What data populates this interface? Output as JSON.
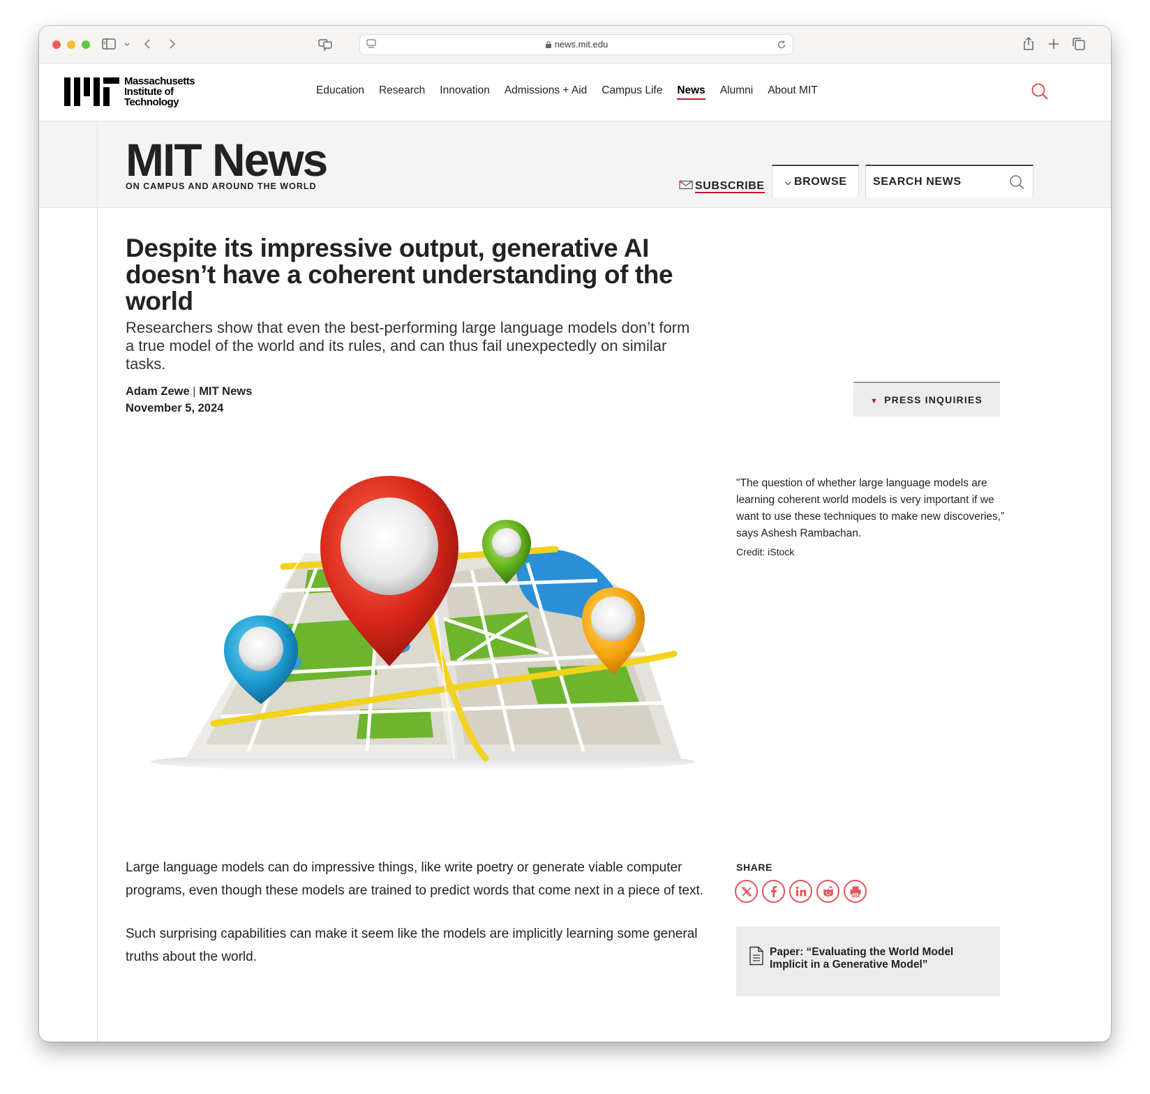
{
  "browser": {
    "url": "news.mit.edu"
  },
  "mit_header": {
    "logo_lines": [
      "Massachusetts",
      "Institute of",
      "Technology"
    ],
    "nav": [
      {
        "label": "Education",
        "active": false
      },
      {
        "label": "Research",
        "active": false
      },
      {
        "label": "Innovation",
        "active": false
      },
      {
        "label": "Admissions + Aid",
        "active": false
      },
      {
        "label": "Campus Life",
        "active": false
      },
      {
        "label": "News",
        "active": true
      },
      {
        "label": "Alumni",
        "active": false
      },
      {
        "label": "About MIT",
        "active": false
      }
    ],
    "accent_color": "#c8102e"
  },
  "news_band": {
    "title": "MIT News",
    "tagline": "ON CAMPUS AND AROUND THE WORLD",
    "subscribe_label": "SUBSCRIBE",
    "browse_label": "BROWSE",
    "search_placeholder": "SEARCH NEWS"
  },
  "article": {
    "headline": "Despite its impressive output, generative AI doesn’t have a coherent understanding of the world",
    "dek": "Researchers show that even the best-performing large language models don’t form a true model of the world and its rules, and can thus fail unexpectedly on similar tasks.",
    "author": "Adam Zewe",
    "separator": "|",
    "outlet": "MIT News",
    "date": "November 5, 2024",
    "press_label": "PRESS INQUIRIES",
    "caption": "\"The question of whether large language models are learning coherent world models is very important if we want to use these techniques to make new discoveries,” says Ashesh Rambachan.",
    "credit": "Credit: iStock",
    "body": [
      "Large language models can do impressive things, like write poetry or generate viable computer programs, even though these models are trained to predict words that come next in a piece of text.",
      "Such surprising capabilities can make it seem like the models are implicitly learning some general truths about the world."
    ],
    "share_label": "SHARE",
    "share_icons": [
      "x-icon",
      "facebook-icon",
      "linkedin-icon",
      "reddit-icon",
      "print-icon"
    ],
    "paper_link": "Paper: “Evaluating the World Model Implicit in a Generative Model”"
  }
}
